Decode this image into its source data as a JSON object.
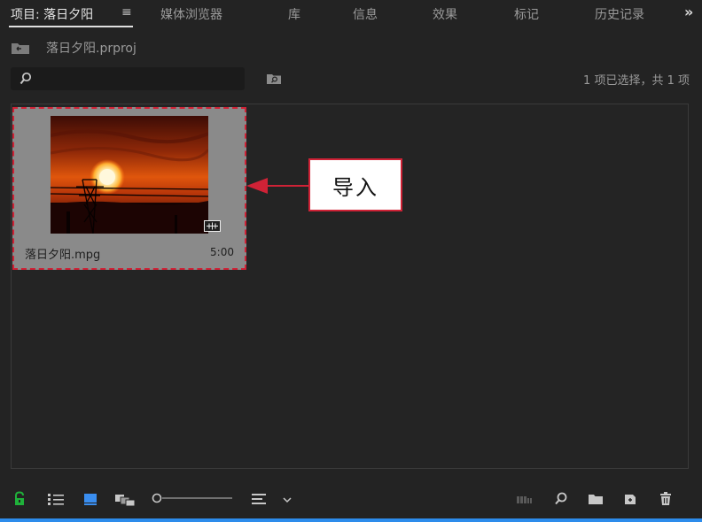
{
  "tabs": [
    {
      "label": "项目: 落日夕阳",
      "active": true
    },
    {
      "label": "媒体浏览器"
    },
    {
      "label": "库"
    },
    {
      "label": "信息"
    },
    {
      "label": "效果"
    },
    {
      "label": "标记"
    },
    {
      "label": "历史记录"
    }
  ],
  "menu_glyph": "≡",
  "overflow_glyph": "»",
  "project": {
    "name": "落日夕阳.prproj"
  },
  "search": {
    "value": "",
    "placeholder": ""
  },
  "selection_status": "1 项已选择，共 1 项",
  "clip": {
    "name": "落日夕阳.mpg",
    "duration": "5:00"
  },
  "callout": {
    "label": "导入"
  },
  "colors": {
    "background": "#232323",
    "accent_blue": "#2d8ceb",
    "highlight_red": "#cf2236",
    "lock_green": "#1fb13a",
    "clip_card": "#8a8a8a"
  },
  "bottom_toolbar": {
    "left": [
      "lock-icon",
      "list-view-icon",
      "icon-view-icon",
      "freeform-view-icon",
      "zoom-slider",
      "sort-icon"
    ],
    "right": [
      "automate-to-sequence-icon",
      "find-icon",
      "new-bin-icon",
      "new-item-icon",
      "trash-icon"
    ]
  }
}
